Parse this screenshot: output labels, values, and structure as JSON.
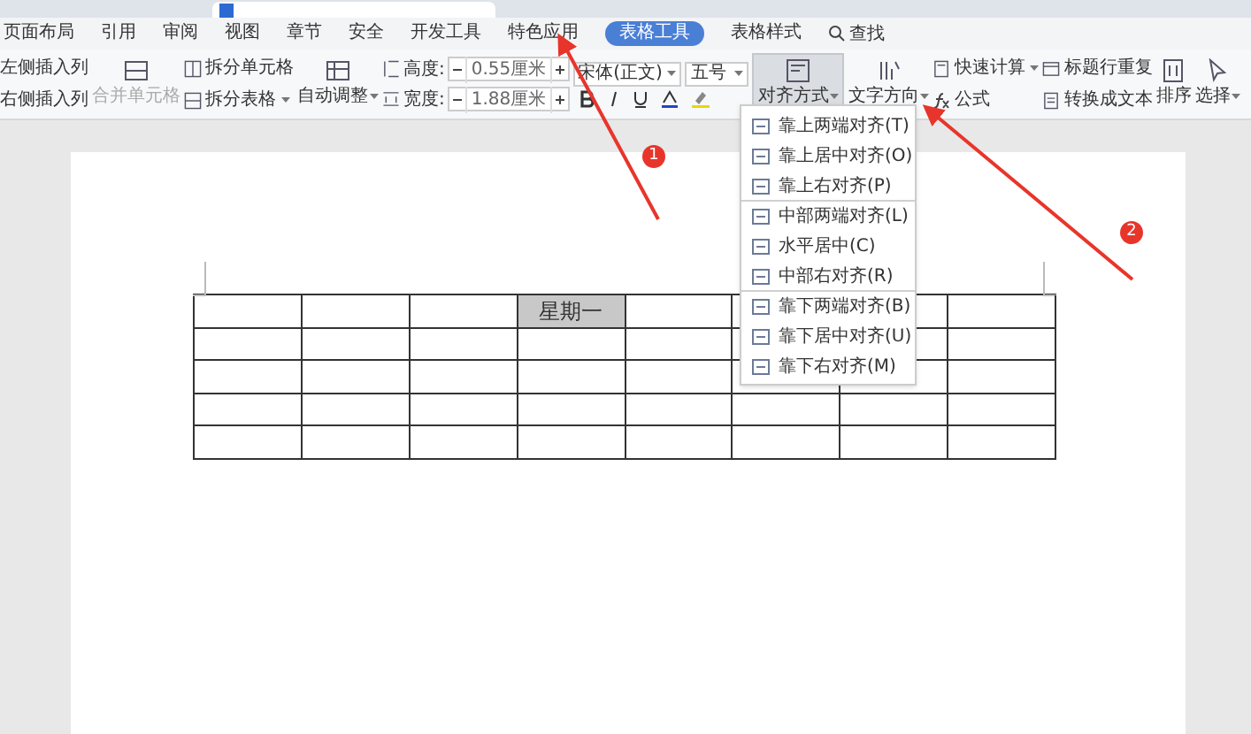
{
  "tabs": [
    {
      "label": "页面布局",
      "selected": false
    },
    {
      "label": "引用",
      "selected": false
    },
    {
      "label": "审阅",
      "selected": false
    },
    {
      "label": "视图",
      "selected": false
    },
    {
      "label": "章节",
      "selected": false
    },
    {
      "label": "安全",
      "selected": false
    },
    {
      "label": "开发工具",
      "selected": false
    },
    {
      "label": "特色应用",
      "selected": false
    },
    {
      "label": "表格工具",
      "selected": true
    },
    {
      "label": "表格样式",
      "selected": false
    }
  ],
  "search": {
    "label": "查找"
  },
  "ribbon": {
    "insert_left": "左侧插入列",
    "insert_right": "右侧插入列",
    "merge": {
      "label": "合并单元格",
      "disabled": true
    },
    "split_cells": "拆分单元格",
    "split_table": "拆分表格",
    "autofit": "自动调整",
    "height": {
      "label": "高度:",
      "value": "0.55厘米"
    },
    "width": {
      "label": "宽度:",
      "value": "1.88厘米"
    },
    "font": "宋体(正文)",
    "size": "五号",
    "align": {
      "label": "对齐方式",
      "selected": true
    },
    "text_direction": "文字方向",
    "quick_calc": "快速计算",
    "repeat_header": "标题行重复",
    "formula": "公式",
    "to_text": "转换成文本",
    "sort": "排序",
    "select": "选择"
  },
  "align_menu": [
    {
      "label": "靠上两端对齐(T)",
      "divider_above": false
    },
    {
      "label": "靠上居中对齐(O)",
      "divider_above": false
    },
    {
      "label": "靠上右对齐(P)",
      "divider_above": false
    },
    {
      "label": "中部两端对齐(L)",
      "divider_above": true
    },
    {
      "label": "水平居中(C)",
      "divider_above": false
    },
    {
      "label": "中部右对齐(R)",
      "divider_above": false
    },
    {
      "label": "靠下两端对齐(B)",
      "divider_above": true
    },
    {
      "label": "靠下居中对齐(U)",
      "divider_above": false
    },
    {
      "label": "靠下右对齐(M)",
      "divider_above": false
    }
  ],
  "table": {
    "rows": [
      {
        "cells": [
          {
            "selected": false
          },
          {
            "selected": false
          },
          {
            "selected": false
          },
          {
            "text": "星期一",
            "selected": true
          },
          {
            "selected": false
          },
          {
            "selected": false
          },
          {
            "selected": false
          },
          {
            "selected": false
          }
        ]
      },
      {
        "cells": [
          {
            "selected": false
          },
          {
            "selected": false
          },
          {
            "selected": false
          },
          {
            "selected": false
          },
          {
            "selected": false
          },
          {
            "selected": false
          },
          {
            "selected": false
          },
          {
            "selected": false
          }
        ]
      },
      {
        "cells": [
          {
            "selected": false
          },
          {
            "selected": false
          },
          {
            "selected": false
          },
          {
            "selected": false
          },
          {
            "selected": false
          },
          {
            "selected": false
          },
          {
            "selected": false
          },
          {
            "selected": false
          }
        ]
      },
      {
        "cells": [
          {
            "selected": false
          },
          {
            "selected": false
          },
          {
            "selected": false
          },
          {
            "selected": false
          },
          {
            "selected": false
          },
          {
            "selected": false
          },
          {
            "selected": false
          },
          {
            "selected": false
          }
        ]
      },
      {
        "cells": [
          {
            "selected": false
          },
          {
            "selected": false
          },
          {
            "selected": false
          },
          {
            "selected": false
          },
          {
            "selected": false
          },
          {
            "selected": false
          },
          {
            "selected": false
          },
          {
            "selected": false
          }
        ]
      }
    ]
  },
  "callouts": [
    "1",
    "2"
  ]
}
